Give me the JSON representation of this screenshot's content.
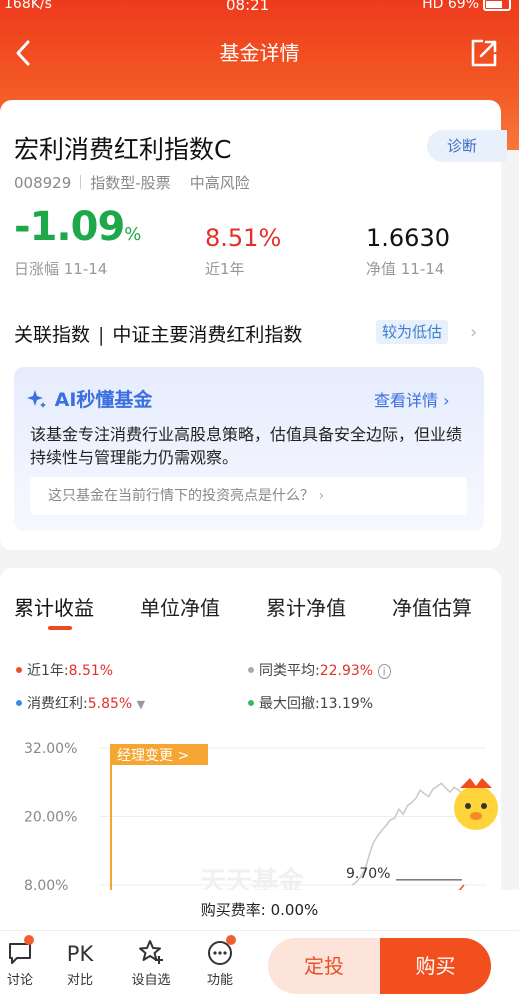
{
  "status": {
    "left": "168K/s",
    "time": "08:21",
    "right": "HD",
    "battery": "69%"
  },
  "nav": {
    "title": "基金详情"
  },
  "fund": {
    "name": "宏利消费红利指数C",
    "code": "008929",
    "type": "指数型-股票",
    "risk": "中高风险",
    "diagnose": "诊断",
    "day_change": "-1.09",
    "day_change_unit": "%",
    "day_change_label": "日涨幅 11-14",
    "year_return": "8.51%",
    "year_return_label": "近1年",
    "nav": "1.6630",
    "nav_label": "净值 11-14"
  },
  "related": {
    "label": "关联指数",
    "index": "中证主要消费红利指数",
    "tag": "较为低估"
  },
  "ai": {
    "title": "AI秒懂基金",
    "more": "查看详情",
    "text": "该基金专注消费行业高股息策略，估值具备安全边际，但业绩持续性与管理能力仍需观察。",
    "question": "这只基金在当前行情下的投资亮点是什么？"
  },
  "tabs": [
    "累计收益",
    "单位净值",
    "累计净值",
    "净值估算"
  ],
  "legend": {
    "near_year_label": "近1年:",
    "near_year_value": "8.51%",
    "peer_label": "同类平均:",
    "peer_value": "22.93%",
    "index_label": "消费红利:",
    "index_value": "5.85%",
    "drawdown_label": "最大回撤:",
    "drawdown_value": "13.19%"
  },
  "chart_data": {
    "type": "line",
    "y_ticks": [
      "32.00%",
      "20.00%",
      "8.00%"
    ],
    "ylim": [
      8,
      32
    ],
    "annotation": "经理变更 >",
    "end_label": "9.70%",
    "watermark": "天天基金",
    "series": [
      {
        "values": [
          8,
          8.5,
          9.4,
          10.6,
          13.1,
          15.4,
          16.6,
          17.6,
          18.4,
          19.4,
          19.7,
          21.3,
          20.4,
          21.9,
          22.4,
          23.2,
          24.6,
          24.0,
          23.5,
          24.8,
          25.3,
          25.8,
          25.0,
          24.3,
          25.1,
          24.6,
          24.0,
          23.6
        ]
      },
      {
        "values": [
          6.3,
          6.6,
          7.2,
          8.0
        ]
      }
    ],
    "colors": {
      "peer": "#c8c8c8",
      "annotation": "#f5a531",
      "fund": "#e8522a"
    }
  },
  "fee": {
    "label": "购买费率:",
    "value": "0.00%"
  },
  "bottom": {
    "discuss": "讨论",
    "compare_icon": "PK",
    "compare": "对比",
    "watch": "设自选",
    "function": "功能",
    "auto_invest": "定投",
    "buy": "购买"
  }
}
